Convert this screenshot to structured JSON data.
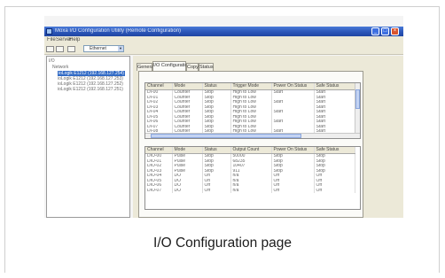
{
  "caption": "I/O Configuration page",
  "window": {
    "title": "Moxa I/O Configuration Utility (Remote Configuration)"
  },
  "menubar": {
    "items": [
      "File",
      "Server",
      "Help"
    ]
  },
  "toolbar": {
    "interface_select": "Ethernet"
  },
  "tree": {
    "root": "I/O",
    "group": "Network",
    "devices": [
      "ioLogik E1212 (192.168.127.254)",
      "ioLogik E1212 (192.168.127.253)",
      "ioLogik E1212 (192.168.127.252)",
      "ioLogik E1212 (192.168.127.251)"
    ],
    "selected_index": 0
  },
  "tabs": [
    {
      "label": "General",
      "active": false
    },
    {
      "label": "I/O Configuration",
      "active": true
    },
    {
      "label": "Copy",
      "active": false
    },
    {
      "label": "Status",
      "active": false
    }
  ],
  "upper_table": {
    "columns": [
      "Channel",
      "Mode",
      "Status",
      "Trigger Mode",
      "Power On Status",
      "Safe Status"
    ],
    "rows": [
      [
        "DI-00",
        "Counter",
        "Stop",
        "High to Low",
        "Start",
        "Start"
      ],
      [
        "DI-01",
        "Counter",
        "Stop",
        "High to Low",
        "",
        "Start"
      ],
      [
        "DI-02",
        "Counter",
        "Stop",
        "High to Low",
        "Start",
        "Start"
      ],
      [
        "DI-03",
        "Counter",
        "Stop",
        "High to Low",
        "",
        "Start"
      ],
      [
        "DI-04",
        "Counter",
        "Stop",
        "High to Low",
        "Start",
        "Start"
      ],
      [
        "DI-05",
        "Counter",
        "Stop",
        "High to Low",
        "",
        "Start"
      ],
      [
        "DI-06",
        "Counter",
        "Stop",
        "High to Low",
        "Start",
        "Start"
      ],
      [
        "DI-07",
        "Counter",
        "Stop",
        "High to Low",
        "",
        "Start"
      ],
      [
        "DI-08",
        "Counter",
        "Stop",
        "High to Low",
        "Start",
        "Start"
      ],
      [
        "DI-09",
        "Counter",
        "Stop",
        "High to Low",
        "",
        "Start"
      ]
    ]
  },
  "lower_table": {
    "columns": [
      "Channel",
      "Mode",
      "Status",
      "Output Count",
      "Power On Status",
      "Safe Status"
    ],
    "rows": [
      [
        "DIO-00",
        "Pulse",
        "Stop",
        "50000",
        "Stop",
        "Stop"
      ],
      [
        "DIO-01",
        "Pulse",
        "Stop",
        "68235",
        "Stop",
        "Stop"
      ],
      [
        "DIO-02",
        "Pulse",
        "Stop",
        "10407",
        "Stop",
        "Stop"
      ],
      [
        "DIO-03",
        "Pulse",
        "Stop",
        "911",
        "Stop",
        "Stop"
      ],
      [
        "DIO-04",
        "DO",
        "On",
        "n/a",
        "Off",
        "Off"
      ],
      [
        "DIO-05",
        "DO",
        "On",
        "n/a",
        "Off",
        "Off"
      ],
      [
        "DIO-06",
        "DO",
        "Off",
        "n/a",
        "Off",
        "Off"
      ],
      [
        "DIO-07",
        "DO",
        "Off",
        "n/a",
        "Off",
        "Off"
      ]
    ]
  }
}
